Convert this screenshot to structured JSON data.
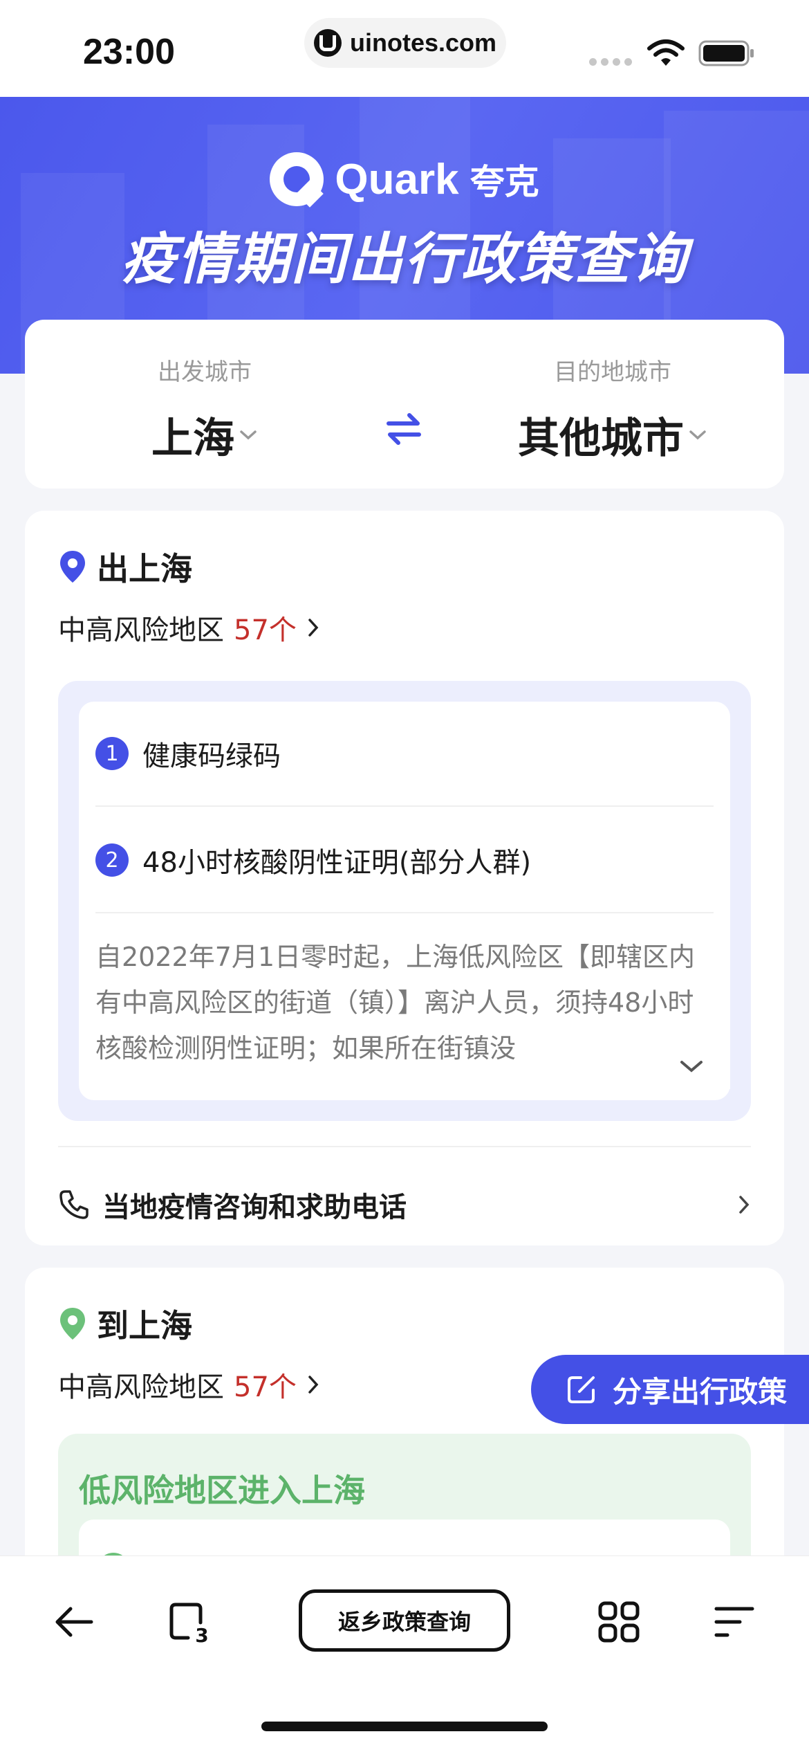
{
  "status_bar": {
    "time": "23:00",
    "url": "uinotes.com"
  },
  "header": {
    "brand_name": "Quark",
    "brand_cn": "夸克",
    "title": "疫情期间出行政策查询"
  },
  "city_selector": {
    "from_label": "出发城市",
    "from_value": "上海",
    "to_label": "目的地城市",
    "to_value": "其他城市"
  },
  "departure": {
    "title": "出上海",
    "risk_label": "中高风险地区",
    "risk_count": "57个",
    "requirements": [
      {
        "num": "1",
        "text": "健康码绿码"
      },
      {
        "num": "2",
        "text": "48小时核酸阴性证明(部分人群)"
      }
    ],
    "description": "自2022年7月1日零时起，上海低风险区【即辖区内有中高风险区的街道（镇）】离沪人员，须持48小时核酸检测阴性证明；如果所在街镇没",
    "hotline": "当地疫情咨询和求助电话"
  },
  "arrival": {
    "title": "到上海",
    "risk_label": "中高风险地区",
    "risk_count": "57个",
    "low_risk_title": "低风险地区进入上海"
  },
  "share_button": {
    "label": "分享出行政策"
  },
  "toolbar": {
    "center_label": "返乡政策查询",
    "tabs_count": "3"
  },
  "colors": {
    "accent": "#4450e6",
    "risk_red": "#c4302b",
    "green": "#5cb36a"
  }
}
